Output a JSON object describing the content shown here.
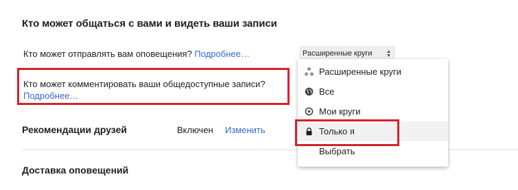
{
  "section": {
    "title": "Кто может общаться с вами и видеть ваши записи"
  },
  "notifications": {
    "question": "Кто может отправлять вам оповещения?",
    "more_link": "Подробнее…"
  },
  "comments": {
    "question": "Кто может комментировать ваши общедоступные записи?",
    "more_link": "Подробнее…"
  },
  "friend_recommendations": {
    "title": "Рекомендации друзей",
    "status": "Включен",
    "change_link": "Изменить"
  },
  "delivery": {
    "title": "Доставка оповещений"
  },
  "select": {
    "current_value": "Расширенные круги"
  },
  "dropdown": {
    "items": [
      {
        "label": "Расширенные круги",
        "icon": "extended-circles-icon"
      },
      {
        "label": "Все",
        "icon": "globe-icon"
      },
      {
        "label": "Мои круги",
        "icon": "circles-icon"
      },
      {
        "label": "Только я",
        "icon": "lock-icon",
        "selected": true
      },
      {
        "label": "Выбрать",
        "icon": ""
      }
    ]
  },
  "colors": {
    "link": "#3367d6",
    "highlight_box": "#d6212b",
    "selected_row": "#f1f1f1"
  }
}
